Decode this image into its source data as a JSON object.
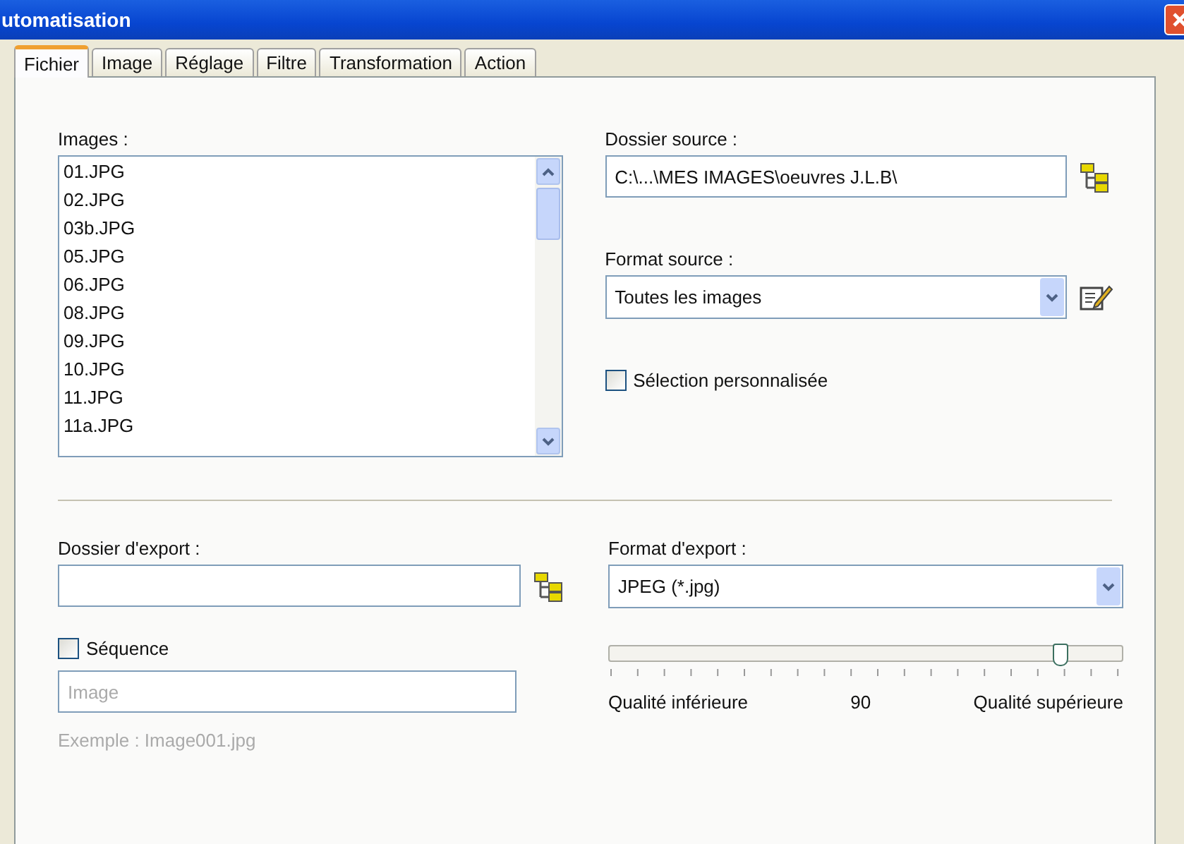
{
  "window": {
    "title": "utomatisation"
  },
  "tabs": [
    {
      "label": "Fichier",
      "selected": true
    },
    {
      "label": "Image",
      "selected": false
    },
    {
      "label": "Réglage",
      "selected": false
    },
    {
      "label": "Filtre",
      "selected": false
    },
    {
      "label": "Transformation",
      "selected": false
    },
    {
      "label": "Action",
      "selected": false
    }
  ],
  "images": {
    "label": "Images :",
    "items": [
      "01.JPG",
      "02.JPG",
      "03b.JPG",
      "05.JPG",
      "06.JPG",
      "08.JPG",
      "09.JPG",
      "10.JPG",
      "11.JPG",
      "11a.JPG"
    ]
  },
  "source_folder": {
    "label": "Dossier source :",
    "value": "C:\\...\\MES IMAGES\\oeuvres J.L.B\\"
  },
  "source_format": {
    "label": "Format source :",
    "value": "Toutes les images"
  },
  "custom_selection": {
    "label": "Sélection personnalisée",
    "checked": false
  },
  "export_folder": {
    "label": "Dossier d'export :"
  },
  "sequence": {
    "label": "Séquence",
    "checked": false,
    "placeholder": "Image",
    "example": "Exemple : Image001.jpg"
  },
  "export_format": {
    "label": "Format d'export :",
    "value": "JPEG (*.jpg)"
  },
  "quality": {
    "level": 0.88,
    "low_label": "Qualité inférieure",
    "reading": "90",
    "high_label": "Qualité supérieure"
  }
}
